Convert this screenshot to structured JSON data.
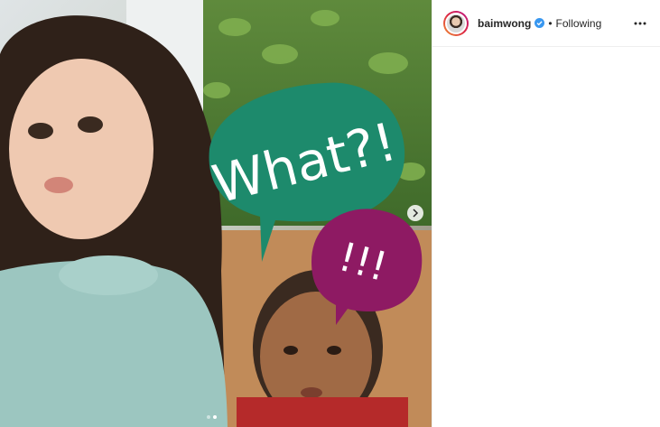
{
  "post": {
    "username": "baimwong",
    "separator": "•",
    "follow_status": "Following",
    "sticker_green_text": "What?!",
    "sticker_purple_text": "!!!",
    "carousel": {
      "count": 2,
      "active_index": 1
    }
  },
  "icons": {
    "verified": "verified-badge-icon",
    "more": "more-options-icon",
    "next": "chevron-right-icon"
  },
  "colors": {
    "verified_blue": "#3897f0",
    "sticker_green": "#1d8a6c",
    "sticker_purple": "#8e1a63"
  }
}
